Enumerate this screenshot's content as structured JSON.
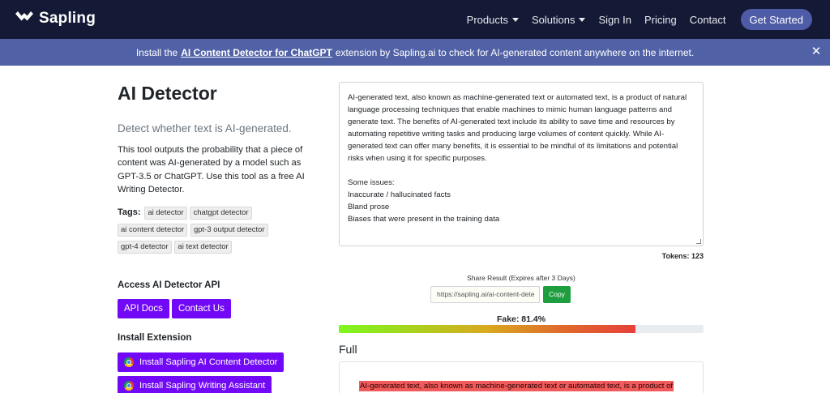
{
  "nav": {
    "brand": "Sapling",
    "links": [
      "Products",
      "Solutions",
      "Sign In",
      "Pricing",
      "Contact"
    ],
    "cta": "Get Started"
  },
  "banner": {
    "prefix": "Install the",
    "link": "AI Content Detector for ChatGPT",
    "suffix": "extension by Sapling.ai to check for AI-generated content anywhere on the internet.",
    "close": "✕"
  },
  "left": {
    "title": "AI Detector",
    "subtitle": "Detect whether text is AI-generated.",
    "description": "This tool outputs the probability that a piece of content was AI-generated by a model such as GPT-3.5 or ChatGPT. Use this tool as a free AI Writing Detector.",
    "tags_label": "Tags",
    "tags": [
      "ai detector",
      "chatgpt detector",
      "ai content detector",
      "gpt-3 output detector",
      "gpt-4 detector",
      "ai text detector"
    ],
    "api_heading": "Access AI Detector API",
    "api_docs": "API Docs",
    "contact_us": "Contact Us",
    "ext_heading": "Install Extension",
    "ext_buttons": [
      "Install Sapling AI Content Detector",
      "Install Sapling Writing Assistant"
    ]
  },
  "editor": {
    "paragraph": "AI-generated text, also known as machine-generated text or automated text, is a product of natural language processing techniques that enable machines to mimic human language patterns and generate text. The benefits of AI-generated text include its ability to save time and resources by automating repetitive writing tasks and producing large volumes of content quickly. While AI-generated text can offer many benefits, it is essential to be mindful of its limitations and potential risks when using it for specific purposes.",
    "issues_heading": "Some issues:",
    "issues": [
      "Inaccurate / hallucinated facts",
      "Bland prose",
      "Biases that were present in the training data"
    ]
  },
  "tokens": "Tokens: 123",
  "share": {
    "label": "Share Result (Expires after 3 Days)",
    "url": "https://sapling.ai/ai-content-dete",
    "copy": "Copy"
  },
  "result": {
    "fake_label": "Fake: 81.4%",
    "fake_fraction": 0.814,
    "full_heading": "Full",
    "highlight_text": "AI-generated text, also known as machine-generated text or automated text, is a product of"
  }
}
